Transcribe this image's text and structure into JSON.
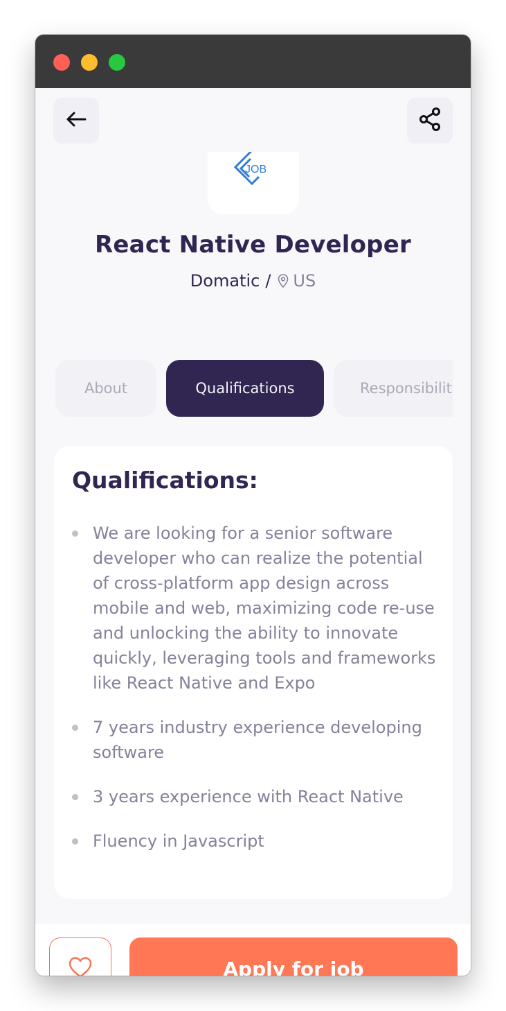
{
  "header": {
    "back_icon": "arrow-left-icon",
    "share_icon": "share-icon"
  },
  "logo": {
    "text": "JOB",
    "color": "#2f7cd8"
  },
  "job": {
    "title": "React Native Developer",
    "company": "Domatic",
    "separator": "/",
    "location": "US",
    "location_icon": "location-pin-icon"
  },
  "tabs": [
    {
      "label": "About",
      "active": false
    },
    {
      "label": "Qualifications",
      "active": true
    },
    {
      "label": "Responsibilities",
      "active": false
    }
  ],
  "section": {
    "title": "Qualifications:",
    "points": [
      "We are looking for a senior software developer who can realize the potential of cross-platform app design across mobile and web, maximizing code re-use and unlocking the ability to innovate quickly, leveraging tools and frameworks like React Native and Expo",
      "7 years industry experience developing software",
      "3 years experience with React Native",
      "Fluency in Javascript"
    ]
  },
  "footer": {
    "like_icon": "heart-icon",
    "apply_label": "Apply for job"
  },
  "colors": {
    "primary": "#312651",
    "accent": "#ff7754",
    "muted": "#83829a",
    "background": "#f8f8fb"
  }
}
